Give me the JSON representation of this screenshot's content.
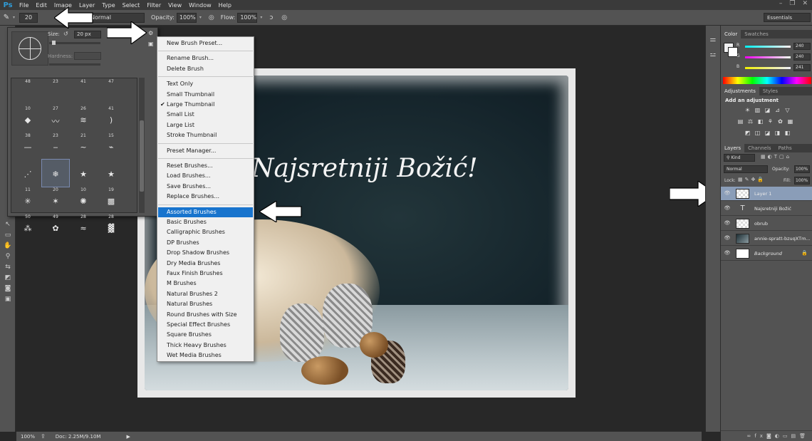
{
  "menubar": {
    "logo": "Ps",
    "items": [
      "File",
      "Edit",
      "Image",
      "Layer",
      "Type",
      "Select",
      "Filter",
      "View",
      "Window",
      "Help"
    ]
  },
  "options": {
    "brush_size": "20",
    "mode_value": "Normal",
    "opacity_label": "Opacity:",
    "opacity_value": "100%",
    "flow_label": "Flow:",
    "flow_value": "100%",
    "workspace": "Essentials"
  },
  "brush_panel": {
    "size_label": "Size:",
    "size_value": "20 px",
    "hardness_label": "Hardness:",
    "cells": [
      {
        "num": "48",
        "glyph": ""
      },
      {
        "num": "23",
        "glyph": ""
      },
      {
        "num": "41",
        "glyph": ""
      },
      {
        "num": "47",
        "glyph": ""
      },
      {
        "num": "10",
        "glyph": "◆"
      },
      {
        "num": "27",
        "glyph": "〰"
      },
      {
        "num": "26",
        "glyph": "≋"
      },
      {
        "num": "41",
        "glyph": ")"
      },
      {
        "num": "38",
        "glyph": "—"
      },
      {
        "num": "23",
        "glyph": "‒"
      },
      {
        "num": "21",
        "glyph": "~"
      },
      {
        "num": "15",
        "glyph": "⌁"
      },
      {
        "num": "",
        "glyph": "⋰"
      },
      {
        "num": "",
        "glyph": "❄"
      },
      {
        "num": "",
        "glyph": "★"
      },
      {
        "num": "",
        "glyph": "★"
      },
      {
        "num": "11",
        "glyph": "✳"
      },
      {
        "num": "20",
        "glyph": "✶"
      },
      {
        "num": "10",
        "glyph": "✺"
      },
      {
        "num": "19",
        "glyph": "▩"
      },
      {
        "num": "50",
        "glyph": "⁂"
      },
      {
        "num": "49",
        "glyph": "✿"
      },
      {
        "num": "28",
        "glyph": "≈"
      },
      {
        "num": "28",
        "glyph": "▓"
      }
    ]
  },
  "dropdown": {
    "groups": [
      [
        "New Brush Preset..."
      ],
      [
        "Rename Brush...",
        "Delete Brush"
      ],
      [
        "Text Only",
        "Small Thumbnail",
        "Large Thumbnail",
        "Small List",
        "Large List",
        "Stroke Thumbnail"
      ],
      [
        "Preset Manager..."
      ],
      [
        "Reset Brushes...",
        "Load Brushes...",
        "Save Brushes...",
        "Replace Brushes..."
      ],
      [
        "Assorted Brushes",
        "Basic Brushes",
        "Calligraphic Brushes",
        "DP Brushes",
        "Drop Shadow Brushes",
        "Dry Media Brushes",
        "Faux Finish Brushes",
        "M Brushes",
        "Natural Brushes 2",
        "Natural Brushes",
        "Round Brushes with Size",
        "Special Effect Brushes",
        "Square Brushes",
        "Thick Heavy Brushes",
        "Wet Media Brushes"
      ]
    ],
    "checked_item": "Large Thumbnail",
    "active_item": "Assorted Brushes"
  },
  "canvas": {
    "greeting": "Najsretniji Božić!"
  },
  "status": {
    "zoom": "100%",
    "doc": "Doc: 2.25M/9.10M"
  },
  "color_panel": {
    "tabs": [
      "Color",
      "Swatches"
    ],
    "r_label": "R",
    "r_value": "240",
    "g_label": "G",
    "g_value": "240",
    "b_label": "B",
    "b_value": "241"
  },
  "adjustments_panel": {
    "tabs": [
      "Adjustments",
      "Styles"
    ],
    "heading": "Add an adjustment"
  },
  "layers_panel": {
    "tabs": [
      "Layers",
      "Channels",
      "Paths"
    ],
    "kind_label": "Kind",
    "blend_mode": "Normal",
    "opacity_label": "Opacity:",
    "opacity_value": "100%",
    "lock_label": "Lock:",
    "fill_label": "Fill:",
    "fill_value": "100%",
    "layers": [
      {
        "name": "Layer 1",
        "selected": true
      },
      {
        "name": "Najsretniji Božić",
        "selected": false
      },
      {
        "name": "obrub",
        "selected": false
      },
      {
        "name": "annie-spratt-bzuqXTm...",
        "selected": false
      },
      {
        "name": "Background",
        "selected": false
      }
    ]
  },
  "colors": {
    "menu_highlight": "#1874cd",
    "panel_bg": "#535353",
    "layer_selected": "#8a9db8"
  }
}
